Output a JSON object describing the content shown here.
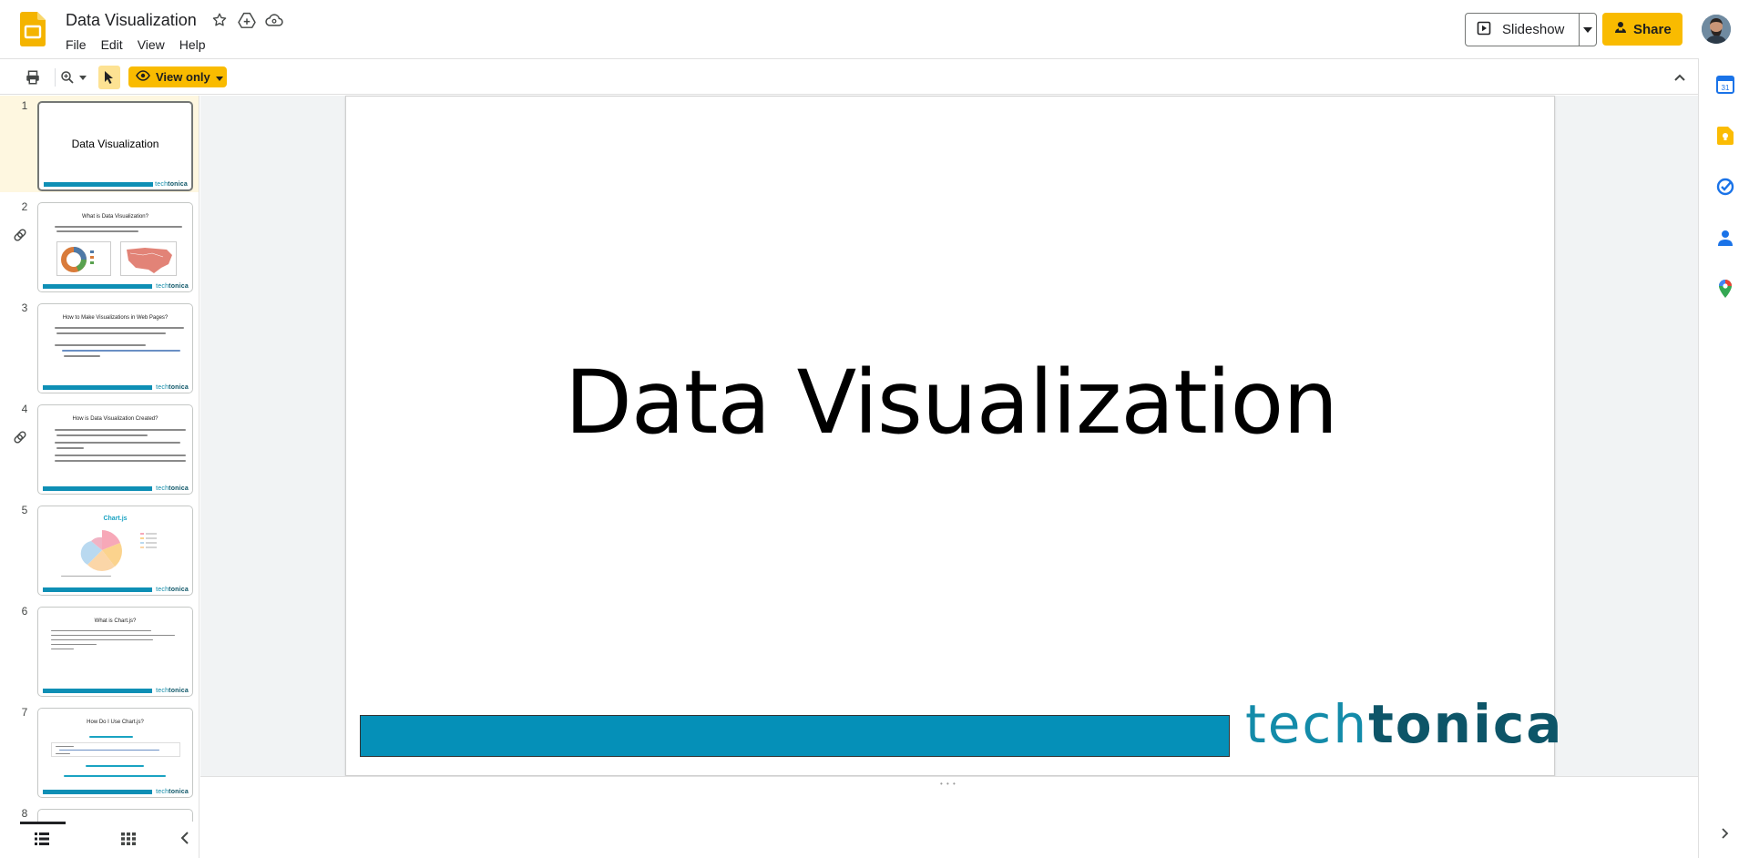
{
  "document": {
    "title": "Data Visualization"
  },
  "menu": {
    "items": [
      "File",
      "Edit",
      "View",
      "Help"
    ]
  },
  "header": {
    "slideshow_label": "Slideshow",
    "share_label": "Share"
  },
  "toolbar": {
    "mode_label": "View only"
  },
  "filmstrip": {
    "slides": [
      {
        "number": "1",
        "title": "Data Visualization"
      },
      {
        "number": "2",
        "title": "What is Data Visualization?"
      },
      {
        "number": "3",
        "title": "How to Make Visualizations in Web Pages?"
      },
      {
        "number": "4",
        "title": "How is Data Visualization Created?"
      },
      {
        "number": "5",
        "title": "Chart.js"
      },
      {
        "number": "6",
        "title": "What is Chart.js?"
      },
      {
        "number": "7",
        "title": "How Do I Use Chart.js?"
      },
      {
        "number": "8",
        "title": ""
      }
    ],
    "brand_light": "tech",
    "brand_bold": "tonica"
  },
  "slide": {
    "title": "Data Visualization",
    "brand_light": "tech",
    "brand_bold": "tonica"
  },
  "colors": {
    "accent_yellow": "#f9bb00",
    "brand_teal": "#0590b8",
    "brand_dark": "#0d5568"
  }
}
